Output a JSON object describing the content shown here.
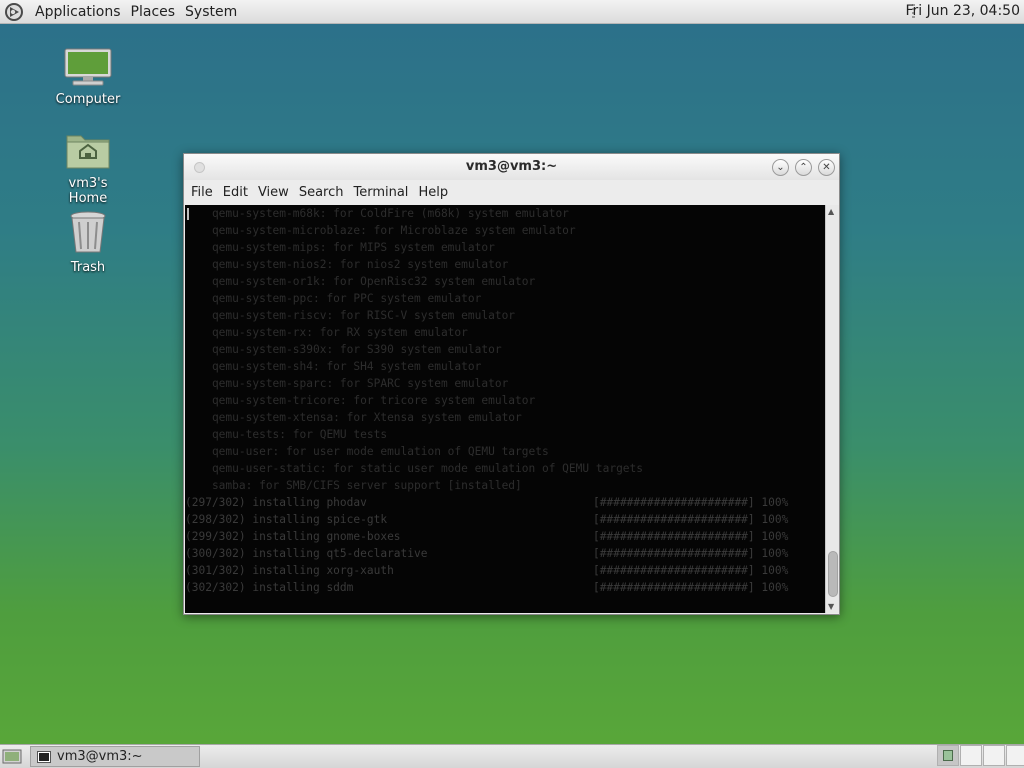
{
  "top_panel": {
    "menus": [
      "Applications",
      "Places",
      "System"
    ],
    "clock": "Fri Jun 23, 04:50"
  },
  "desktop": {
    "icons": [
      {
        "label": "Computer",
        "icon": "computer-icon"
      },
      {
        "label": "vm3's Home",
        "icon": "home-folder-icon"
      },
      {
        "label": "Trash",
        "icon": "trash-icon"
      }
    ]
  },
  "terminal": {
    "title": "vm3@vm3:~",
    "menus": [
      "File",
      "Edit",
      "View",
      "Search",
      "Terminal",
      "Help"
    ],
    "lines": [
      {
        "text": "    qemu-system-m68k: for ColdFire (m68k) system emulator",
        "color": "#2d2d2d"
      },
      {
        "text": "    qemu-system-microblaze: for Microblaze system emulator",
        "color": "#2d2d2d"
      },
      {
        "text": "    qemu-system-mips: for MIPS system emulator",
        "color": "#2d2d2d"
      },
      {
        "text": "    qemu-system-nios2: for nios2 system emulator",
        "color": "#2d2d2d"
      },
      {
        "text": "    qemu-system-or1k: for OpenRisc32 system emulator",
        "color": "#2d2d2d"
      },
      {
        "text": "    qemu-system-ppc: for PPC system emulator",
        "color": "#2d2d2d"
      },
      {
        "text": "    qemu-system-riscv: for RISC-V system emulator",
        "color": "#2d2d2d"
      },
      {
        "text": "    qemu-system-rx: for RX system emulator",
        "color": "#2d2d2d"
      },
      {
        "text": "    qemu-system-s390x: for S390 system emulator",
        "color": "#2d2d2d"
      },
      {
        "text": "    qemu-system-sh4: for SH4 system emulator",
        "color": "#2d2d2d"
      },
      {
        "text": "    qemu-system-sparc: for SPARC system emulator",
        "color": "#2d2d2d"
      },
      {
        "text": "    qemu-system-tricore: for tricore system emulator",
        "color": "#2d2d2d"
      },
      {
        "text": "    qemu-system-xtensa: for Xtensa system emulator",
        "color": "#2d2d2d"
      },
      {
        "text": "    qemu-tests: for QEMU tests",
        "color": "#2d2d2d"
      },
      {
        "text": "    qemu-user: for user mode emulation of QEMU targets",
        "color": "#2d2d2d"
      },
      {
        "text": "    qemu-user-static: for static user mode emulation of QEMU targets",
        "color": "#2d2d2d"
      },
      {
        "text": "    samba: for SMB/CIFS server support [installed]",
        "color": "#2d2d2d"
      },
      {
        "text": "(297/302) installing phodav",
        "pct": "[######################] 100%",
        "color": "#3a3a3a"
      },
      {
        "text": "(298/302) installing spice-gtk",
        "pct": "[######################] 100%",
        "color": "#3a3a3a"
      },
      {
        "text": "(299/302) installing gnome-boxes",
        "pct": "[######################] 100%",
        "color": "#3a3a3a"
      },
      {
        "text": "(300/302) installing qt5-declarative",
        "pct": "[######################] 100%",
        "color": "#3a3a3a"
      },
      {
        "text": "(301/302) installing xorg-xauth",
        "pct": "[######################] 100%",
        "color": "#3a3a3a"
      },
      {
        "text": "(302/302) installing sddm",
        "pct": "[######################] 100%",
        "color": "#3a3a3a"
      }
    ]
  },
  "bottom_panel": {
    "task_label": "vm3@vm3:~",
    "workspace_count": 4,
    "active_workspace": 1
  }
}
